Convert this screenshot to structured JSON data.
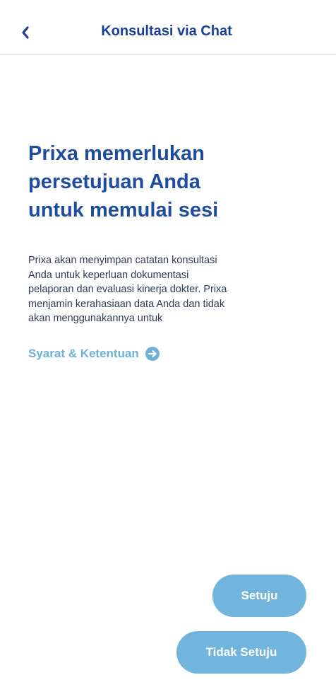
{
  "header": {
    "title": "Konsultasi via Chat",
    "back_icon": "chevron-left-icon"
  },
  "main": {
    "headline_lines": [
      "Prixa memerlukan",
      "persetujuan Anda",
      "untuk memulai sesi"
    ],
    "body_lines": [
      "Prixa akan menyimpan catatan konsultasi",
      "Anda untuk keperluan dokumentasi",
      "pelaporan dan evaluasi kinerja dokter. Prixa",
      "menjamin kerahasiaan data Anda dan tidak",
      "akan menggunakannya untuk"
    ],
    "terms_link": "Syarat & Ketentuan",
    "terms_icon": "arrow-right-circle-icon"
  },
  "actions": {
    "agree_label": "Setuju",
    "disagree_label": "Tidak Setuju"
  },
  "colors": {
    "primary": "#1e4c9e",
    "link": "#6db1d8",
    "button": "#72b5dc"
  }
}
